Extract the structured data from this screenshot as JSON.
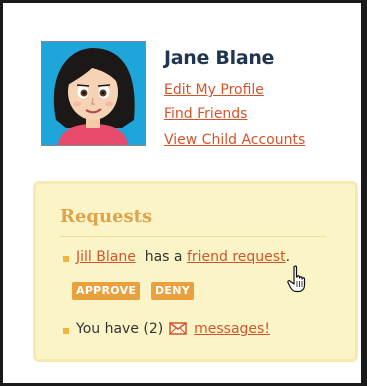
{
  "profile": {
    "name": "Jane Blane",
    "links": {
      "edit": "Edit My Profile",
      "friends": "Find Friends",
      "child": "View Child Accounts"
    }
  },
  "requests": {
    "title": "Requests",
    "friend_request": {
      "person": "Jill Blane",
      "middle": "has a",
      "link": "friend request",
      "end": ".",
      "approve_label": "APPROVE",
      "deny_label": "DENY"
    },
    "messages": {
      "prefix": "You have (2)",
      "link": "messages!"
    }
  },
  "colors": {
    "link": "#d4542a",
    "name": "#1f3550",
    "button": "#e8a13c",
    "panel": "#fbf4c7",
    "avatar_bg": "#1ea5d9"
  },
  "icons": {
    "avatar": "cartoon-girl-avatar",
    "message": "envelope-icon",
    "pointer": "hand-pointer-cursor"
  }
}
